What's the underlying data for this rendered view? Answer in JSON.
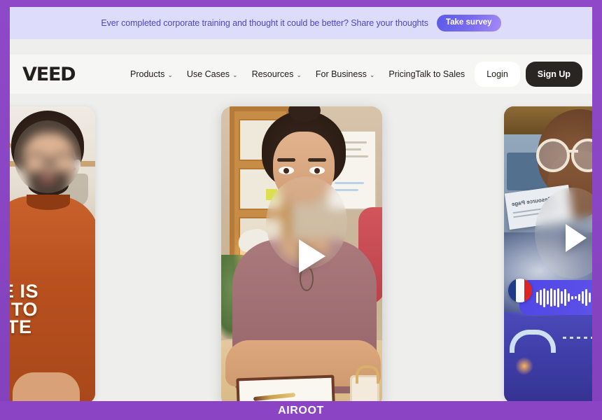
{
  "frame": {
    "accent_purple": "#8b45c4",
    "watermark": "AIROOT"
  },
  "promo": {
    "message": "Ever completed corporate training and thought it could be better? Share your thoughts",
    "cta_label": "Take survey",
    "background": "#dedcfb",
    "text_color": "#4f46c9",
    "cta_gradient_start": "#5b5ae8",
    "cta_gradient_end": "#a78bf5"
  },
  "nav": {
    "logo": "VEED",
    "links": [
      {
        "label": "Products",
        "chevron": "⌄"
      },
      {
        "label": "Use Cases",
        "chevron": "⌄"
      },
      {
        "label": "Resources",
        "chevron": "⌄"
      },
      {
        "label": "For Business",
        "chevron": "⌄"
      },
      {
        "label": "Pricing",
        "chevron": ""
      }
    ],
    "talk_to_sales": "Talk to Sales",
    "login": "Login",
    "signup": "Sign Up",
    "signup_bg": "#282523"
  },
  "hero": {
    "background": "#eeeeec",
    "cards": [
      {
        "name": "card-left",
        "caption_lines": [
          "RE IS",
          "W TO",
          "RITE"
        ],
        "has_play_button": false
      },
      {
        "name": "card-center",
        "has_play_button": true
      },
      {
        "name": "card-right",
        "overlay_label": "Resource Page",
        "flag": "france-flag",
        "has_play_button": true
      }
    ]
  }
}
